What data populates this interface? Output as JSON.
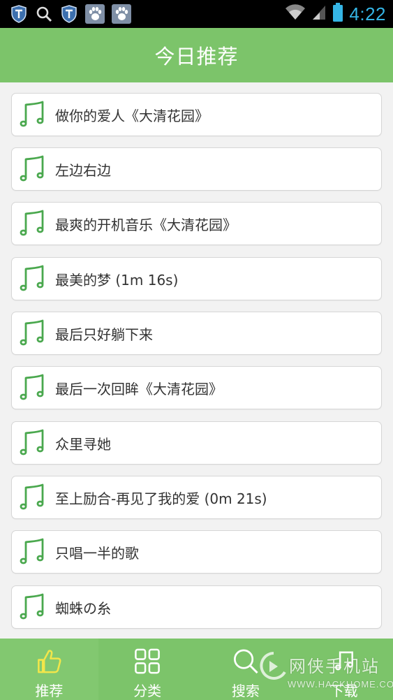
{
  "status_bar": {
    "time": "4:22",
    "left_icons": [
      "shield-icon",
      "search-icon",
      "shield-icon",
      "baidu-paw-icon",
      "baidu-paw-icon"
    ],
    "right_icons": [
      "wifi-icon",
      "signal-icon",
      "battery-icon"
    ],
    "clock_color": "#35b5e5"
  },
  "header": {
    "title": "今日推荐",
    "color": "#7cc46a"
  },
  "songs": [
    {
      "label": "做你的爱人《大清花园》"
    },
    {
      "label": "左边右边"
    },
    {
      "label": "最爽的开机音乐《大清花园》"
    },
    {
      "label": "最美的梦 (1m 16s)"
    },
    {
      "label": "最后只好躺下来"
    },
    {
      "label": "最后一次回眸《大清花园》"
    },
    {
      "label": "众里寻她"
    },
    {
      "label": "至上励合-再见了我的爱 (0m 21s)"
    },
    {
      "label": "只唱一半的歌"
    },
    {
      "label": "蜘蛛の糸"
    }
  ],
  "bottom_nav": {
    "items": [
      {
        "label": "推荐",
        "icon": "thumbs-up-icon",
        "active": true
      },
      {
        "label": "分类",
        "icon": "grid-icon",
        "active": false
      },
      {
        "label": "搜索",
        "icon": "search-icon",
        "active": false
      },
      {
        "label": "下载",
        "icon": "download-icon",
        "active": false
      }
    ]
  },
  "watermark": {
    "text": "网侠手机站",
    "subtext": "WWW.HACKHOME.COM"
  }
}
